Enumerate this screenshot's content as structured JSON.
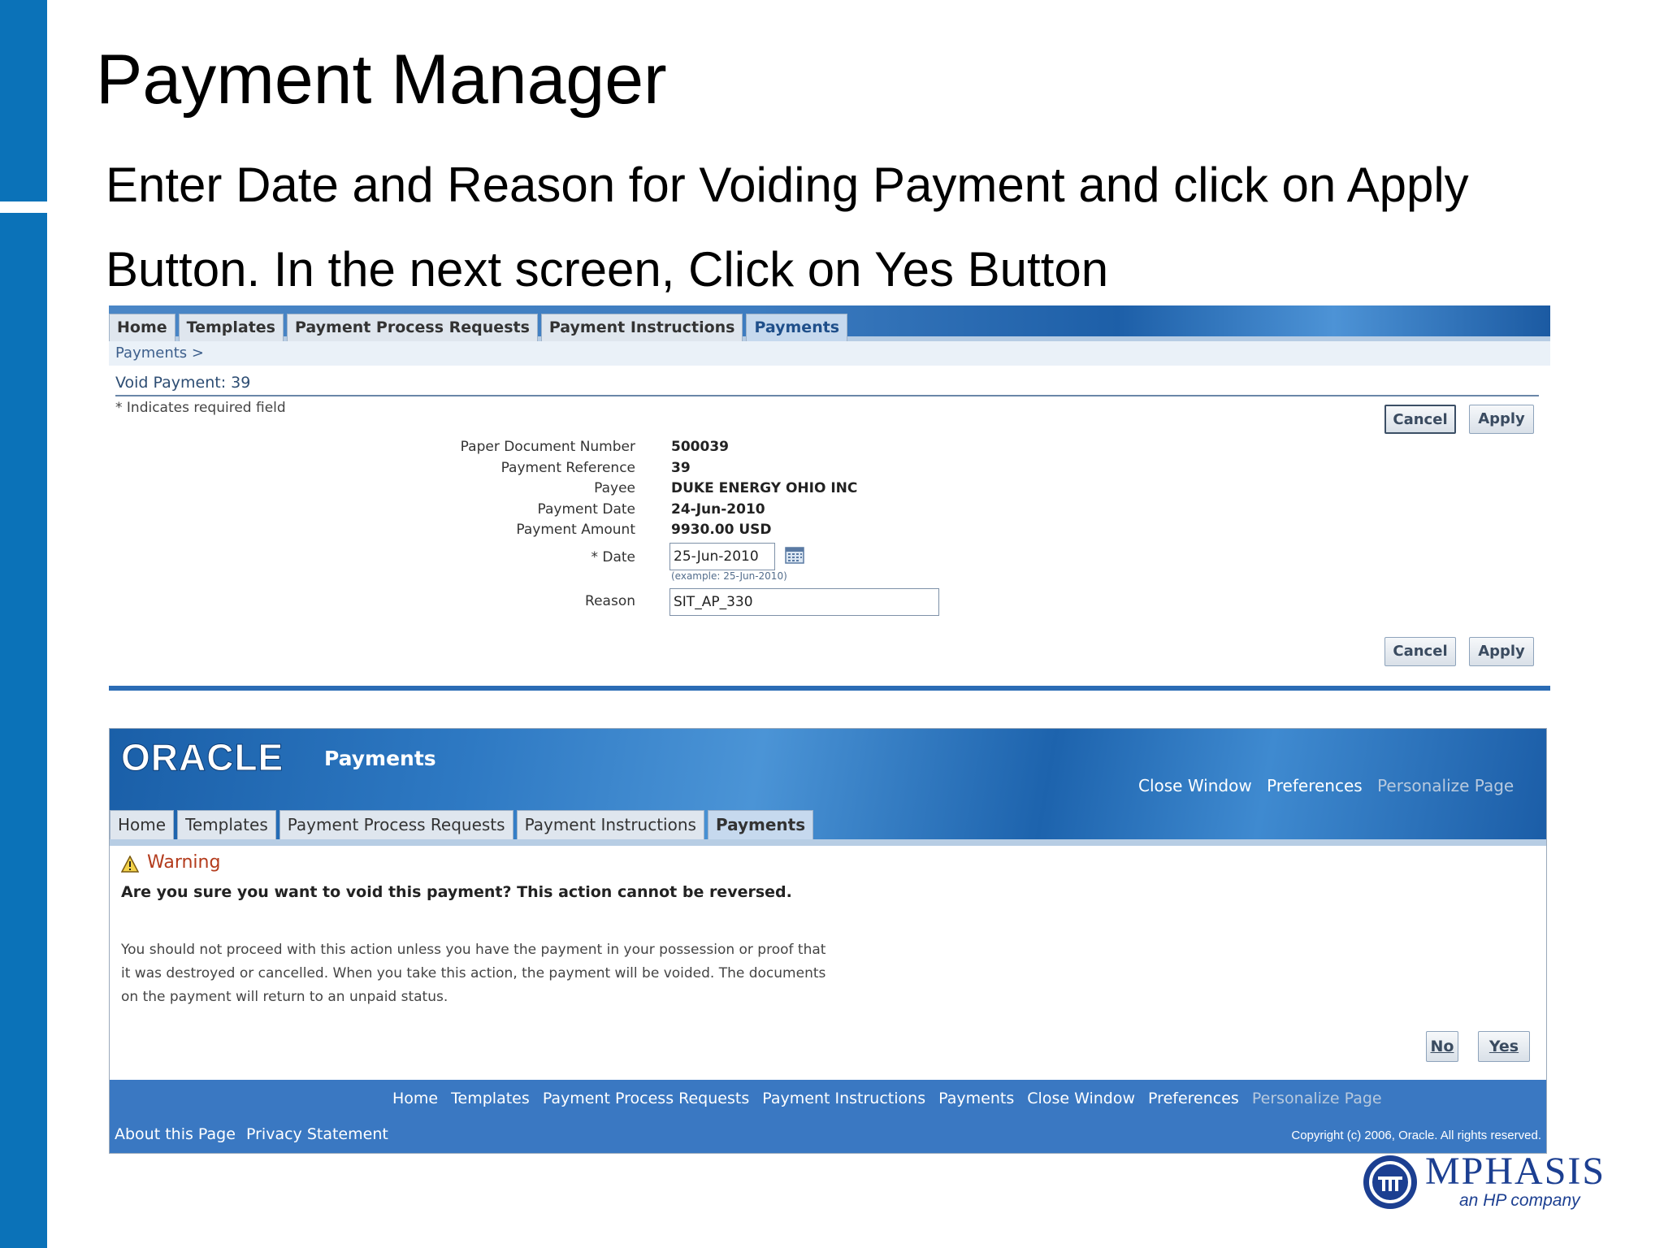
{
  "slide": {
    "title": "Payment Manager",
    "instruction_line1": "Enter Date and Reason for Voiding Payment and click on Apply",
    "instruction_line2": "Button. In the next screen, Click on Yes Button"
  },
  "void_screen": {
    "tabs": [
      "Home",
      "Templates",
      "Payment Process Requests",
      "Payment Instructions",
      "Payments"
    ],
    "active_tab": "Payments",
    "breadcrumb": "Payments  >",
    "page_title": "Void Payment: 39",
    "required_note": "* Indicates required field",
    "buttons": {
      "cancel": "Cancel",
      "apply": "Apply"
    },
    "fields": {
      "paper_document_number": {
        "label": "Paper Document Number",
        "value": "500039"
      },
      "payment_reference": {
        "label": "Payment Reference",
        "value": "39"
      },
      "payee": {
        "label": "Payee",
        "value": "DUKE ENERGY OHIO INC"
      },
      "payment_date": {
        "label": "Payment Date",
        "value": "24-Jun-2010"
      },
      "payment_amount": {
        "label": "Payment Amount",
        "value": "9930.00 USD"
      },
      "date": {
        "label": "* Date",
        "value": "25-Jun-2010",
        "tip": "(example: 25-Jun-2010)"
      },
      "reason": {
        "label": "Reason",
        "value": "SIT_AP_330"
      }
    }
  },
  "warning_screen": {
    "logo_text": "ORACLE",
    "app_name": "Payments",
    "global_links": [
      "Close Window",
      "Preferences",
      "Personalize Page"
    ],
    "tabs": [
      "Home",
      "Templates",
      "Payment Process Requests",
      "Payment Instructions",
      "Payments"
    ],
    "active_tab": "Payments",
    "warning_title": "Warning",
    "question": "Are you sure you want to void this payment? This action cannot be reversed.",
    "body": "You should not proceed with this action unless you have the payment in your possession or proof that it was destroyed or cancelled. When you take this action, the payment will be voided. The documents on the payment will return to an unpaid status.",
    "buttons": {
      "no": "No",
      "yes": "Yes"
    },
    "footer_links": [
      "Home",
      "Templates",
      "Payment Process Requests",
      "Payment Instructions",
      "Payments",
      "Close Window",
      "Preferences",
      "Personalize Page"
    ],
    "about": "About this Page",
    "privacy": "Privacy Statement",
    "copyright": "Copyright (c) 2006, Oracle. All rights reserved."
  },
  "branding": {
    "company": "MPHASIS",
    "tagline": "an HP company"
  },
  "colors": {
    "slide_accent": "#0b72b8",
    "oracle_blue": "#3a78c2",
    "warning_red": "#b33b1c",
    "mphasis_blue": "#1c3f91"
  }
}
